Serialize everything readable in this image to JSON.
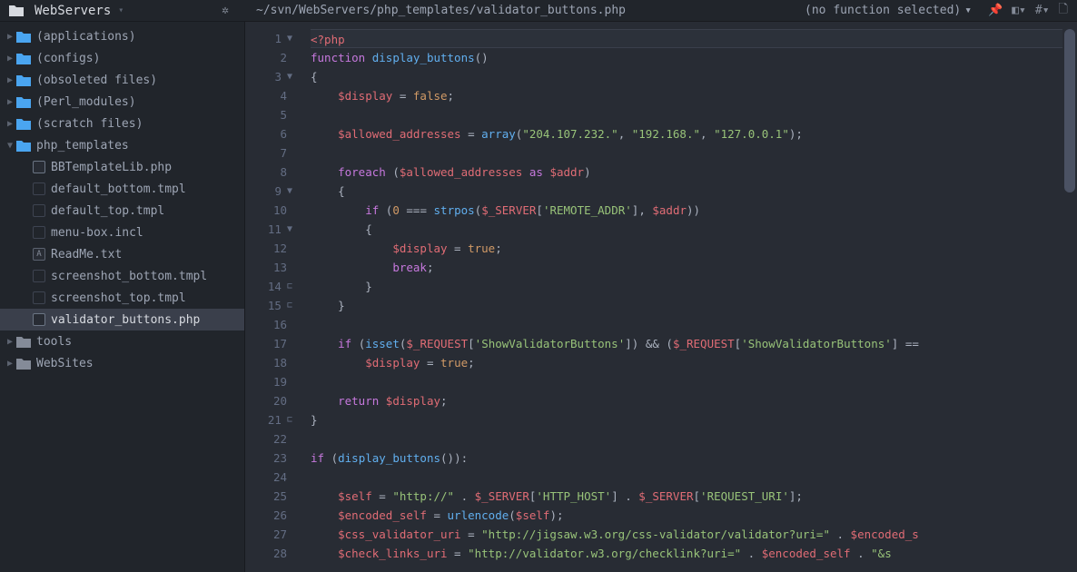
{
  "project": {
    "name": "WebServers",
    "selector_arrow": "▾"
  },
  "topbar": {
    "path": "~/svn/WebServers/php_templates/validator_buttons.php",
    "func_selector": "(no function selected)",
    "func_arrow": "▾"
  },
  "sidebar": {
    "items": [
      {
        "label": "(applications)",
        "depth": 0,
        "kind": "folder",
        "expanded": false
      },
      {
        "label": "(configs)",
        "depth": 0,
        "kind": "folder",
        "expanded": false
      },
      {
        "label": "(obsoleted files)",
        "depth": 0,
        "kind": "folder",
        "expanded": false
      },
      {
        "label": "(Perl_modules)",
        "depth": 0,
        "kind": "folder",
        "expanded": false
      },
      {
        "label": "(scratch files)",
        "depth": 0,
        "kind": "folder",
        "expanded": false
      },
      {
        "label": "php_templates",
        "depth": 0,
        "kind": "folder",
        "expanded": true
      },
      {
        "label": "BBTemplateLib.php",
        "depth": 1,
        "kind": "file",
        "ftype": "php"
      },
      {
        "label": "default_bottom.tmpl",
        "depth": 1,
        "kind": "file",
        "ftype": "tmpl"
      },
      {
        "label": "default_top.tmpl",
        "depth": 1,
        "kind": "file",
        "ftype": "tmpl"
      },
      {
        "label": "menu-box.incl",
        "depth": 1,
        "kind": "file",
        "ftype": "tmpl"
      },
      {
        "label": "ReadMe.txt",
        "depth": 1,
        "kind": "file",
        "ftype": "txt"
      },
      {
        "label": "screenshot_bottom.tmpl",
        "depth": 1,
        "kind": "file",
        "ftype": "tmpl"
      },
      {
        "label": "screenshot_top.tmpl",
        "depth": 1,
        "kind": "file",
        "ftype": "tmpl"
      },
      {
        "label": "validator_buttons.php",
        "depth": 1,
        "kind": "file",
        "ftype": "php",
        "selected": true
      },
      {
        "label": "tools",
        "depth": 0,
        "kind": "folder",
        "expanded": false,
        "grey": true
      },
      {
        "label": "WebSites",
        "depth": 0,
        "kind": "folder",
        "expanded": false,
        "grey": true
      }
    ]
  },
  "editor": {
    "first_line": 1,
    "fold_markers": {
      "1": "▼",
      "3": "▼",
      "9": "▼",
      "11": "▼",
      "14": "⊏",
      "15": "⊏",
      "21": "⊏"
    },
    "lines": [
      {
        "hl": true,
        "tokens": [
          {
            "c": "tok-tag",
            "t": "<?php"
          }
        ]
      },
      {
        "tokens": [
          {
            "c": "tok-key",
            "t": "function"
          },
          {
            "c": "tok-ident",
            "t": " "
          },
          {
            "c": "tok-func",
            "t": "display_buttons"
          },
          {
            "c": "tok-punc",
            "t": "()"
          }
        ]
      },
      {
        "tokens": [
          {
            "c": "tok-punc",
            "t": "{"
          }
        ]
      },
      {
        "tokens": [
          {
            "c": "tok-ident",
            "t": "    "
          },
          {
            "c": "tok-var",
            "t": "$display"
          },
          {
            "c": "tok-op",
            "t": " = "
          },
          {
            "c": "tok-bool",
            "t": "false"
          },
          {
            "c": "tok-punc",
            "t": ";"
          }
        ]
      },
      {
        "tokens": []
      },
      {
        "tokens": [
          {
            "c": "tok-ident",
            "t": "    "
          },
          {
            "c": "tok-var",
            "t": "$allowed_addresses"
          },
          {
            "c": "tok-op",
            "t": " = "
          },
          {
            "c": "tok-func",
            "t": "array"
          },
          {
            "c": "tok-punc",
            "t": "("
          },
          {
            "c": "tok-str",
            "t": "\"204.107.232.\""
          },
          {
            "c": "tok-punc",
            "t": ", "
          },
          {
            "c": "tok-str",
            "t": "\"192.168.\""
          },
          {
            "c": "tok-punc",
            "t": ", "
          },
          {
            "c": "tok-str",
            "t": "\"127.0.0.1\""
          },
          {
            "c": "tok-punc",
            "t": ");"
          }
        ]
      },
      {
        "tokens": []
      },
      {
        "tokens": [
          {
            "c": "tok-ident",
            "t": "    "
          },
          {
            "c": "tok-key",
            "t": "foreach"
          },
          {
            "c": "tok-punc",
            "t": " ("
          },
          {
            "c": "tok-var",
            "t": "$allowed_addresses"
          },
          {
            "c": "tok-ident",
            "t": " "
          },
          {
            "c": "tok-key",
            "t": "as"
          },
          {
            "c": "tok-ident",
            "t": " "
          },
          {
            "c": "tok-var",
            "t": "$addr"
          },
          {
            "c": "tok-punc",
            "t": ")"
          }
        ]
      },
      {
        "tokens": [
          {
            "c": "tok-ident",
            "t": "    "
          },
          {
            "c": "tok-punc",
            "t": "{"
          }
        ]
      },
      {
        "tokens": [
          {
            "c": "tok-ident",
            "t": "        "
          },
          {
            "c": "tok-key",
            "t": "if"
          },
          {
            "c": "tok-punc",
            "t": " ("
          },
          {
            "c": "tok-num",
            "t": "0"
          },
          {
            "c": "tok-op",
            "t": " === "
          },
          {
            "c": "tok-func",
            "t": "strpos"
          },
          {
            "c": "tok-punc",
            "t": "("
          },
          {
            "c": "tok-var",
            "t": "$_SERVER"
          },
          {
            "c": "tok-punc",
            "t": "["
          },
          {
            "c": "tok-str",
            "t": "'REMOTE_ADDR'"
          },
          {
            "c": "tok-punc",
            "t": "], "
          },
          {
            "c": "tok-var",
            "t": "$addr"
          },
          {
            "c": "tok-punc",
            "t": "))"
          }
        ]
      },
      {
        "tokens": [
          {
            "c": "tok-ident",
            "t": "        "
          },
          {
            "c": "tok-punc",
            "t": "{"
          }
        ]
      },
      {
        "tokens": [
          {
            "c": "tok-ident",
            "t": "            "
          },
          {
            "c": "tok-var",
            "t": "$display"
          },
          {
            "c": "tok-op",
            "t": " = "
          },
          {
            "c": "tok-bool",
            "t": "true"
          },
          {
            "c": "tok-punc",
            "t": ";"
          }
        ]
      },
      {
        "tokens": [
          {
            "c": "tok-ident",
            "t": "            "
          },
          {
            "c": "tok-key",
            "t": "break"
          },
          {
            "c": "tok-punc",
            "t": ";"
          }
        ]
      },
      {
        "tokens": [
          {
            "c": "tok-ident",
            "t": "        "
          },
          {
            "c": "tok-punc",
            "t": "}"
          }
        ]
      },
      {
        "tokens": [
          {
            "c": "tok-ident",
            "t": "    "
          },
          {
            "c": "tok-punc",
            "t": "}"
          }
        ]
      },
      {
        "tokens": []
      },
      {
        "tokens": [
          {
            "c": "tok-ident",
            "t": "    "
          },
          {
            "c": "tok-key",
            "t": "if"
          },
          {
            "c": "tok-punc",
            "t": " ("
          },
          {
            "c": "tok-func",
            "t": "isset"
          },
          {
            "c": "tok-punc",
            "t": "("
          },
          {
            "c": "tok-var",
            "t": "$_REQUEST"
          },
          {
            "c": "tok-punc",
            "t": "["
          },
          {
            "c": "tok-str",
            "t": "'ShowValidatorButtons'"
          },
          {
            "c": "tok-punc",
            "t": "]) && ("
          },
          {
            "c": "tok-var",
            "t": "$_REQUEST"
          },
          {
            "c": "tok-punc",
            "t": "["
          },
          {
            "c": "tok-str",
            "t": "'ShowValidatorButtons'"
          },
          {
            "c": "tok-punc",
            "t": "] =="
          }
        ]
      },
      {
        "tokens": [
          {
            "c": "tok-ident",
            "t": "        "
          },
          {
            "c": "tok-var",
            "t": "$display"
          },
          {
            "c": "tok-op",
            "t": " = "
          },
          {
            "c": "tok-bool",
            "t": "true"
          },
          {
            "c": "tok-punc",
            "t": ";"
          }
        ]
      },
      {
        "tokens": []
      },
      {
        "tokens": [
          {
            "c": "tok-ident",
            "t": "    "
          },
          {
            "c": "tok-key",
            "t": "return"
          },
          {
            "c": "tok-ident",
            "t": " "
          },
          {
            "c": "tok-var",
            "t": "$display"
          },
          {
            "c": "tok-punc",
            "t": ";"
          }
        ]
      },
      {
        "tokens": [
          {
            "c": "tok-punc",
            "t": "}"
          }
        ]
      },
      {
        "tokens": []
      },
      {
        "tokens": [
          {
            "c": "tok-key",
            "t": "if"
          },
          {
            "c": "tok-punc",
            "t": " ("
          },
          {
            "c": "tok-func",
            "t": "display_buttons"
          },
          {
            "c": "tok-punc",
            "t": "()):"
          }
        ]
      },
      {
        "tokens": []
      },
      {
        "tokens": [
          {
            "c": "tok-ident",
            "t": "    "
          },
          {
            "c": "tok-var",
            "t": "$self"
          },
          {
            "c": "tok-op",
            "t": " = "
          },
          {
            "c": "tok-str",
            "t": "\"http://\""
          },
          {
            "c": "tok-op",
            "t": " . "
          },
          {
            "c": "tok-var",
            "t": "$_SERVER"
          },
          {
            "c": "tok-punc",
            "t": "["
          },
          {
            "c": "tok-str",
            "t": "'HTTP_HOST'"
          },
          {
            "c": "tok-punc",
            "t": "]"
          },
          {
            "c": "tok-op",
            "t": " . "
          },
          {
            "c": "tok-var",
            "t": "$_SERVER"
          },
          {
            "c": "tok-punc",
            "t": "["
          },
          {
            "c": "tok-str",
            "t": "'REQUEST_URI'"
          },
          {
            "c": "tok-punc",
            "t": "];"
          }
        ]
      },
      {
        "tokens": [
          {
            "c": "tok-ident",
            "t": "    "
          },
          {
            "c": "tok-var",
            "t": "$encoded_self"
          },
          {
            "c": "tok-op",
            "t": " = "
          },
          {
            "c": "tok-func",
            "t": "urlencode"
          },
          {
            "c": "tok-punc",
            "t": "("
          },
          {
            "c": "tok-var",
            "t": "$self"
          },
          {
            "c": "tok-punc",
            "t": ");"
          }
        ]
      },
      {
        "tokens": [
          {
            "c": "tok-ident",
            "t": "    "
          },
          {
            "c": "tok-var",
            "t": "$css_validator_uri"
          },
          {
            "c": "tok-op",
            "t": " = "
          },
          {
            "c": "tok-str",
            "t": "\"http://jigsaw.w3.org/css-validator/validator?uri=\""
          },
          {
            "c": "tok-op",
            "t": " . "
          },
          {
            "c": "tok-var",
            "t": "$encoded_s"
          }
        ]
      },
      {
        "tokens": [
          {
            "c": "tok-ident",
            "t": "    "
          },
          {
            "c": "tok-var",
            "t": "$check_links_uri"
          },
          {
            "c": "tok-op",
            "t": " = "
          },
          {
            "c": "tok-str",
            "t": "\"http://validator.w3.org/checklink?uri=\""
          },
          {
            "c": "tok-op",
            "t": " . "
          },
          {
            "c": "tok-var",
            "t": "$encoded_self"
          },
          {
            "c": "tok-op",
            "t": " . "
          },
          {
            "c": "tok-str",
            "t": "\"&amp;s"
          }
        ]
      }
    ]
  }
}
